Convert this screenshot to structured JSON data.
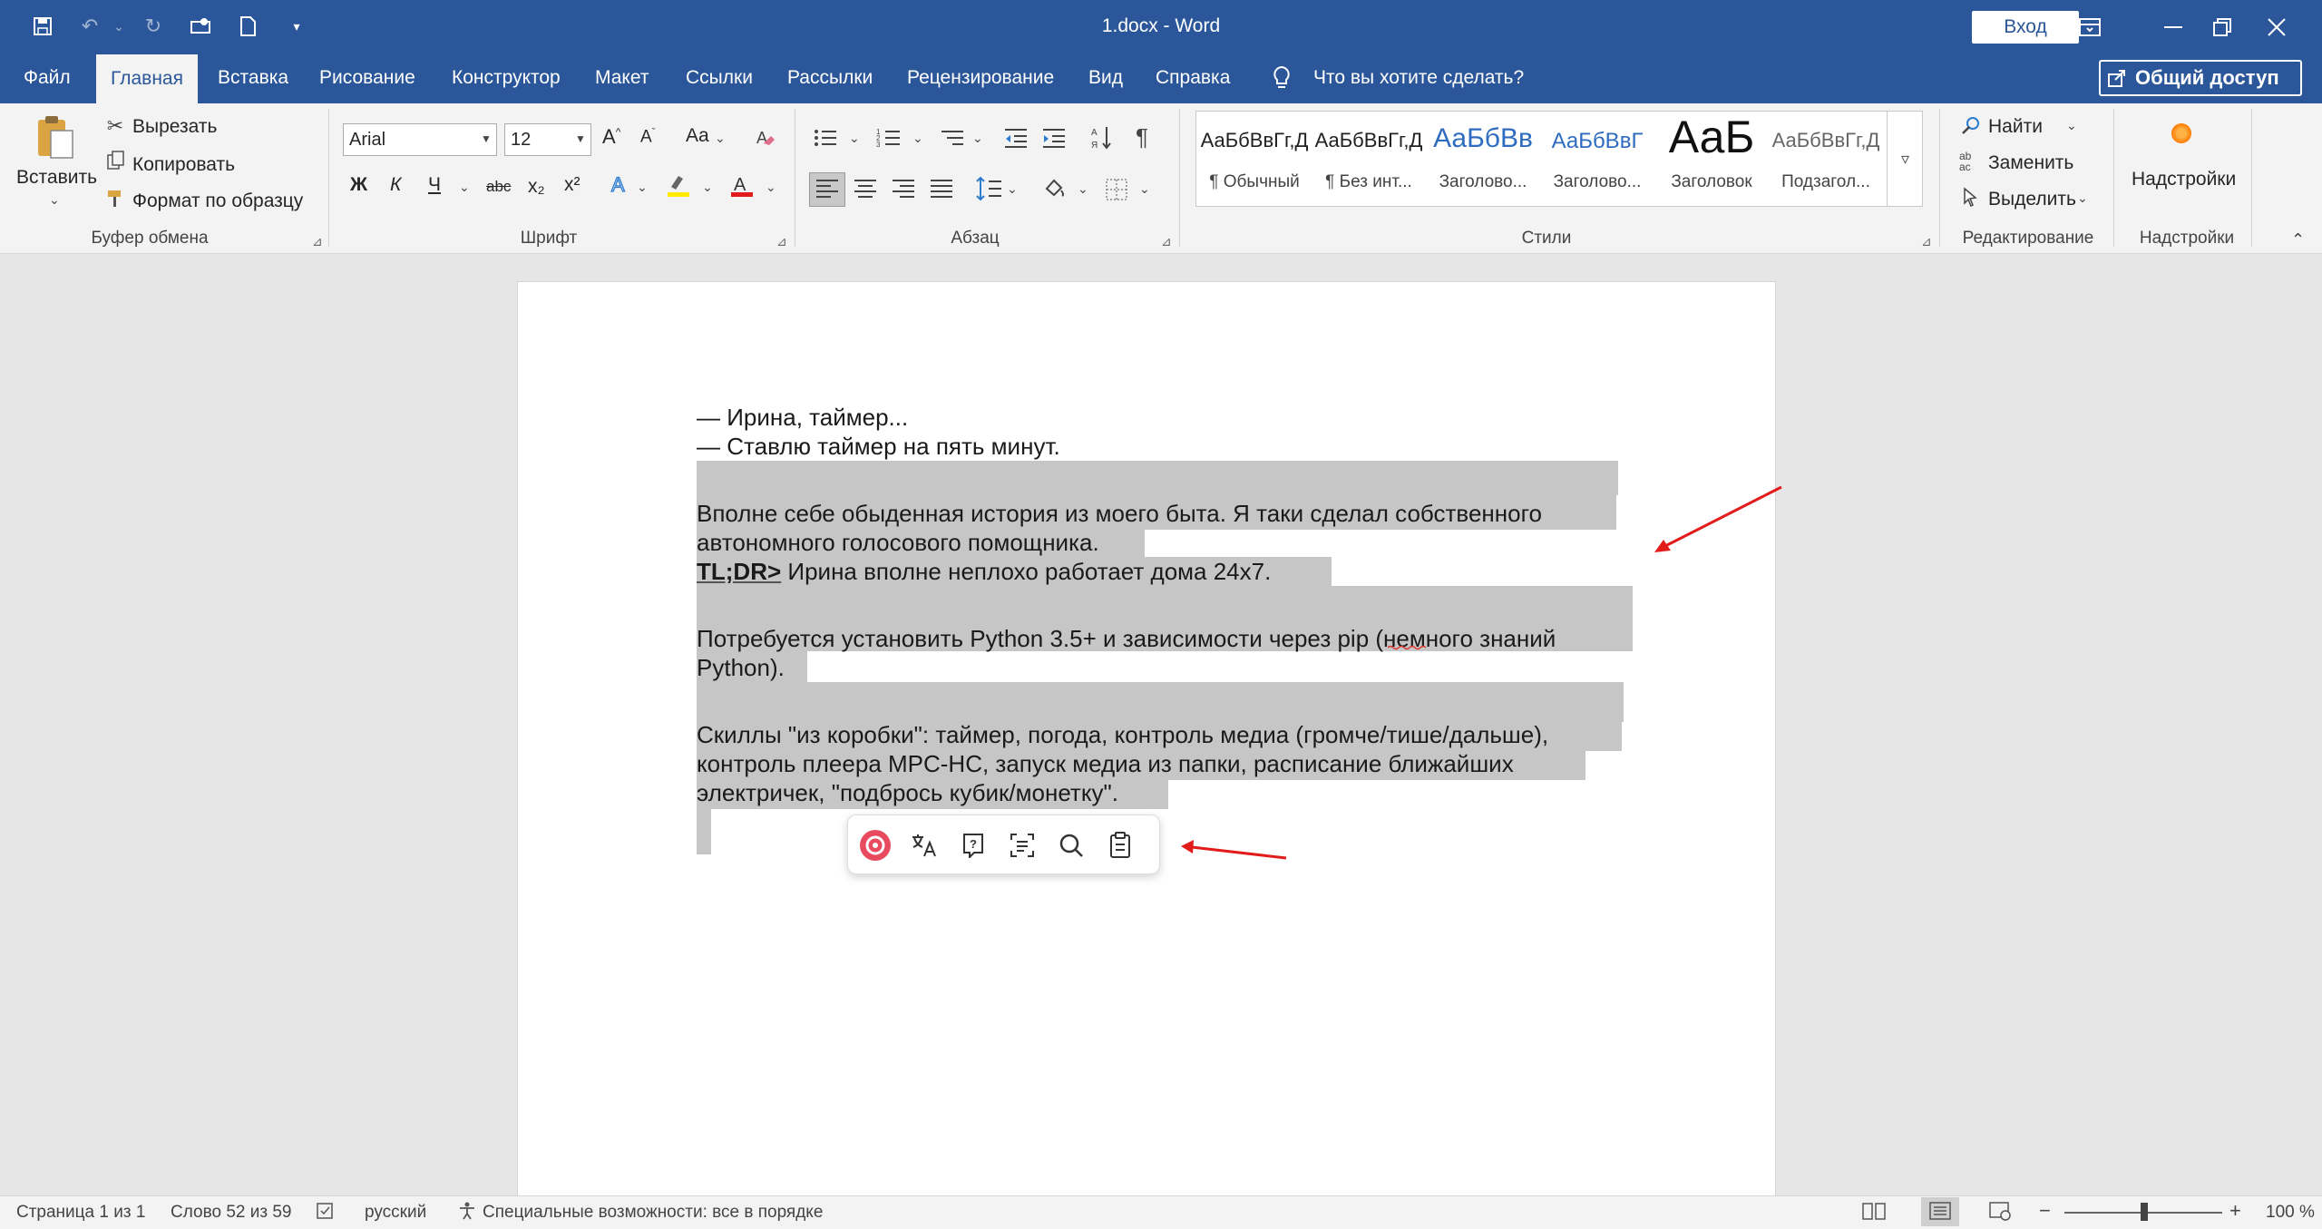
{
  "window": {
    "title": "1.docx  -  Word",
    "sign_in": "Вход"
  },
  "tabs": [
    "Файл",
    "Главная",
    "Вставка",
    "Рисование",
    "Конструктор",
    "Макет",
    "Ссылки",
    "Рассылки",
    "Рецензирование",
    "Вид",
    "Справка"
  ],
  "tell_me": "Что вы хотите сделать?",
  "share": "Общий доступ",
  "ribbon": {
    "clipboard": {
      "paste": "Вставить",
      "cut": "Вырезать",
      "copy": "Копировать",
      "format_painter": "Формат по образцу",
      "label": "Буфер обмена"
    },
    "font": {
      "name": "Arial",
      "size": "12",
      "label": "Шрифт",
      "case_btn": "Aa",
      "bold": "Ж",
      "italic": "К",
      "underline": "Ч",
      "strike": "abc",
      "sub": "x₂",
      "sup": "x²"
    },
    "paragraph": {
      "label": "Абзац"
    },
    "styles": {
      "label": "Стили",
      "items": [
        {
          "sample": "АаБбВвГг,Д",
          "name": "¶ Обычный"
        },
        {
          "sample": "АаБбВвГг,Д",
          "name": "¶ Без инт..."
        },
        {
          "sample": "АаБбВв",
          "name": "Заголово..."
        },
        {
          "sample": "АаБбВвГ",
          "name": "Заголово..."
        },
        {
          "sample": "АаБ",
          "name": "Заголовок"
        },
        {
          "sample": "АаБбВвГг,Д",
          "name": "Подзагол..."
        }
      ]
    },
    "editing": {
      "find": "Найти",
      "replace": "Заменить",
      "select": "Выделить",
      "label": "Редактирование"
    },
    "addins": {
      "button": "Надстройки",
      "label": "Надстройки"
    }
  },
  "document": {
    "line1": "— Ирина, таймер...",
    "line2": "— Ставлю таймер на пять минут.",
    "p1a": "Вполне себе обыденная история из моего быта. Я таки сделал собственного",
    "p1b": "автономного голосового помощника.",
    "p2_bold": "TL;DR>",
    "p2_rest": " Ирина вполне неплохо работает дома 24х7.",
    "p3a": "Потребуется установить Python 3.5+ и зависимости через pip (немного знаний",
    "p3b": "Python).",
    "p4a": "Скиллы \"из коробки\": таймер, погода, контроль медиа (громче/тише/дальше),",
    "p4b": "контроль плеера MPC-HC, запуск медиа из папки, расписание ближайших",
    "p4c": "электричек, \"подбрось кубик/монетку\"."
  },
  "status": {
    "page": "Страница 1 из 1",
    "words": "Слово 52 из 59",
    "lang": "русский",
    "accessibility": "Специальные возможности: все в порядке",
    "zoom": "100 %"
  },
  "colors": {
    "accent": "#2b579a",
    "selection": "#c6c6c6",
    "annotation": "#e21b1b"
  }
}
